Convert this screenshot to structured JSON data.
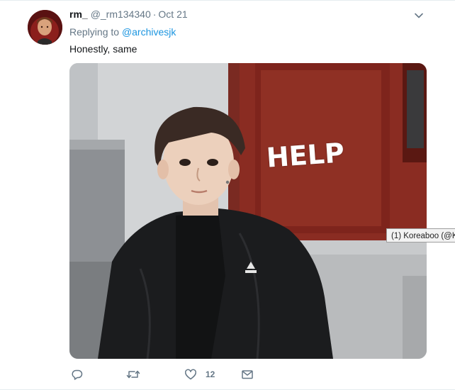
{
  "tweet": {
    "fullname": "rm_",
    "handle": "@_rm134340",
    "separator": "·",
    "timestamp": "Oct 21",
    "replying_prefix": "Replying to ",
    "replying_to": "@archivesjk",
    "text": "Honestly, same",
    "media_caption": "HELP",
    "like_count": "12"
  },
  "tooltip": {
    "text": "(1) Koreaboo (@K"
  },
  "icons": {
    "caret": "chevron-down-icon",
    "reply": "reply-icon",
    "retweet": "retweet-icon",
    "like": "heart-icon",
    "dm": "envelope-icon"
  },
  "colors": {
    "link": "#1b95e0",
    "secondary_text": "#657786",
    "primary_text": "#14171a"
  }
}
